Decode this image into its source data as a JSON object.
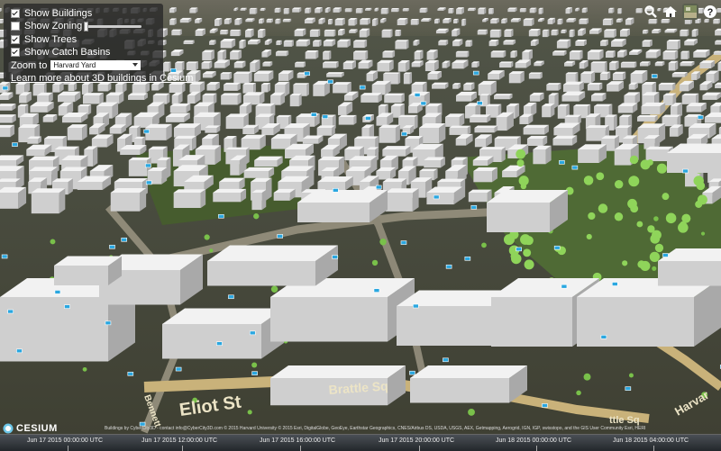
{
  "toolbar": {
    "show_buildings": {
      "label": "Show Buildings",
      "checked": true
    },
    "show_zoning": {
      "label": "Show Zoning",
      "checked": false,
      "opacity": 0
    },
    "show_trees": {
      "label": "Show Trees",
      "checked": true
    },
    "show_catch_basins": {
      "label": "Show Catch Basins",
      "checked": true
    },
    "zoom_to": {
      "label": "Zoom to",
      "selected": "Harvard Yard"
    },
    "learn_more_link": "Learn more about 3D buildings in Cesium"
  },
  "top_right_buttons": [
    "search-icon",
    "home-icon",
    "layers-icon",
    "help-icon"
  ],
  "map_labels": {
    "brattle_sq": "Brattle Sq",
    "eliot_st": "Eliot St",
    "battle_sq_right": "ttle Sq",
    "harvard_st": "Harvar",
    "bennett_st": "Bennett"
  },
  "credits": {
    "logo": "CESIUM",
    "text": "Buildings by CyberCity3D - contact info@CyberCity3D.com  © 2015 Harvard University  © 2015 Esri, DigitalGlobe, GeoEye, Earthstar Geographics, CNES/Airbus DS, USDA, USGS, AEX, Getmapping, Aerogrid, IGN, IGP, swisstopo, and the GIS User Community  Esri, HERE, DeLorme, MapmyIndia, © OpenStreetMap contributors, Microsoft Corp, Earthstar Geographics"
  },
  "timeline": {
    "ticks": [
      "Jun 17 2015 00:00:00 UTC",
      "Jun 17 2015 12:00:00 UTC",
      "Jun 17 2015 16:00:00 UTC",
      "Jun 17 2015 20:00:00 UTC",
      "Jun 18 2015 00:00:00 UTC",
      "Jun 18 2015 04:00:00 UTC"
    ]
  },
  "colors": {
    "panel_bg": "#2a2a2a",
    "building": "#d9d9d9",
    "tree": "#8fd45a",
    "catch_basin": "#2aa7e0",
    "road": "#c9b27a"
  }
}
